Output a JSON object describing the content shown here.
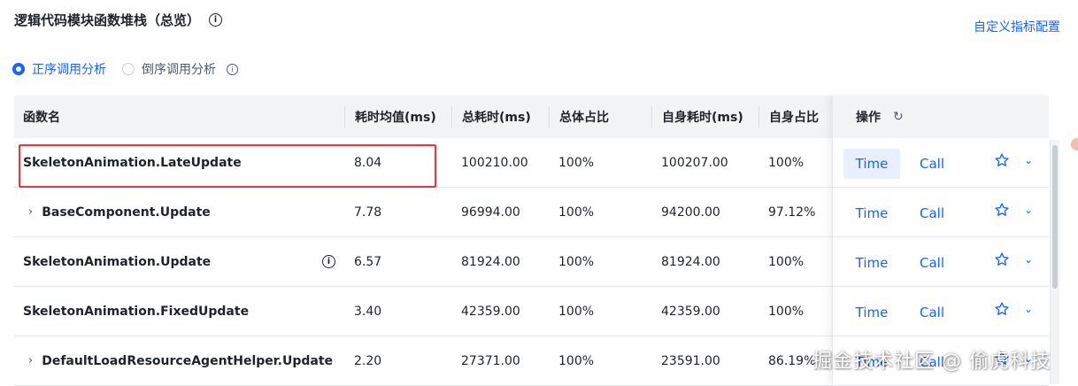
{
  "header": {
    "title": "逻辑代码模块函数堆栈（总览）",
    "info_glyph": "i",
    "custom_metrics_link": "自定义指标配置"
  },
  "analysis_mode": {
    "options": [
      {
        "label": "正序调用分析",
        "selected": true
      },
      {
        "label": "倒序调用分析",
        "selected": false
      }
    ]
  },
  "table": {
    "columns": [
      "函数名",
      "耗时均值(ms)",
      "总耗时(ms)",
      "总体占比",
      "自身耗时(ms)",
      "自身占比"
    ],
    "ops_column": "操作",
    "rows": [
      {
        "name": "SkeletonAnimation.LateUpdate",
        "avg": "8.04",
        "total": "100210.00",
        "overall": "100%",
        "self": "100207.00",
        "self_pct": "100%",
        "expandable": false,
        "info": false
      },
      {
        "name": "BaseComponent.Update",
        "avg": "7.78",
        "total": "96994.00",
        "overall": "100%",
        "self": "94200.00",
        "self_pct": "97.12%",
        "expandable": true,
        "info": false
      },
      {
        "name": "SkeletonAnimation.Update",
        "avg": "6.57",
        "total": "81924.00",
        "overall": "100%",
        "self": "81924.00",
        "self_pct": "100%",
        "expandable": false,
        "info": true
      },
      {
        "name": "SkeletonAnimation.FixedUpdate",
        "avg": "3.40",
        "total": "42359.00",
        "overall": "100%",
        "self": "42359.00",
        "self_pct": "100%",
        "expandable": false,
        "info": false
      },
      {
        "name": "DefaultLoadResourceAgentHelper.Update",
        "avg": "2.20",
        "total": "27371.00",
        "overall": "100%",
        "self": "23591.00",
        "self_pct": "86.19%",
        "expandable": true,
        "info": false
      }
    ]
  },
  "actions": {
    "time_label": "Time",
    "call_label": "Call",
    "active_row": 0
  },
  "watermark": "掘金技术社区 @ 偷虎科技",
  "colors": {
    "accent": "#1664ff",
    "highlight": "#e8363a",
    "header_bg": "#f2f3f5"
  }
}
